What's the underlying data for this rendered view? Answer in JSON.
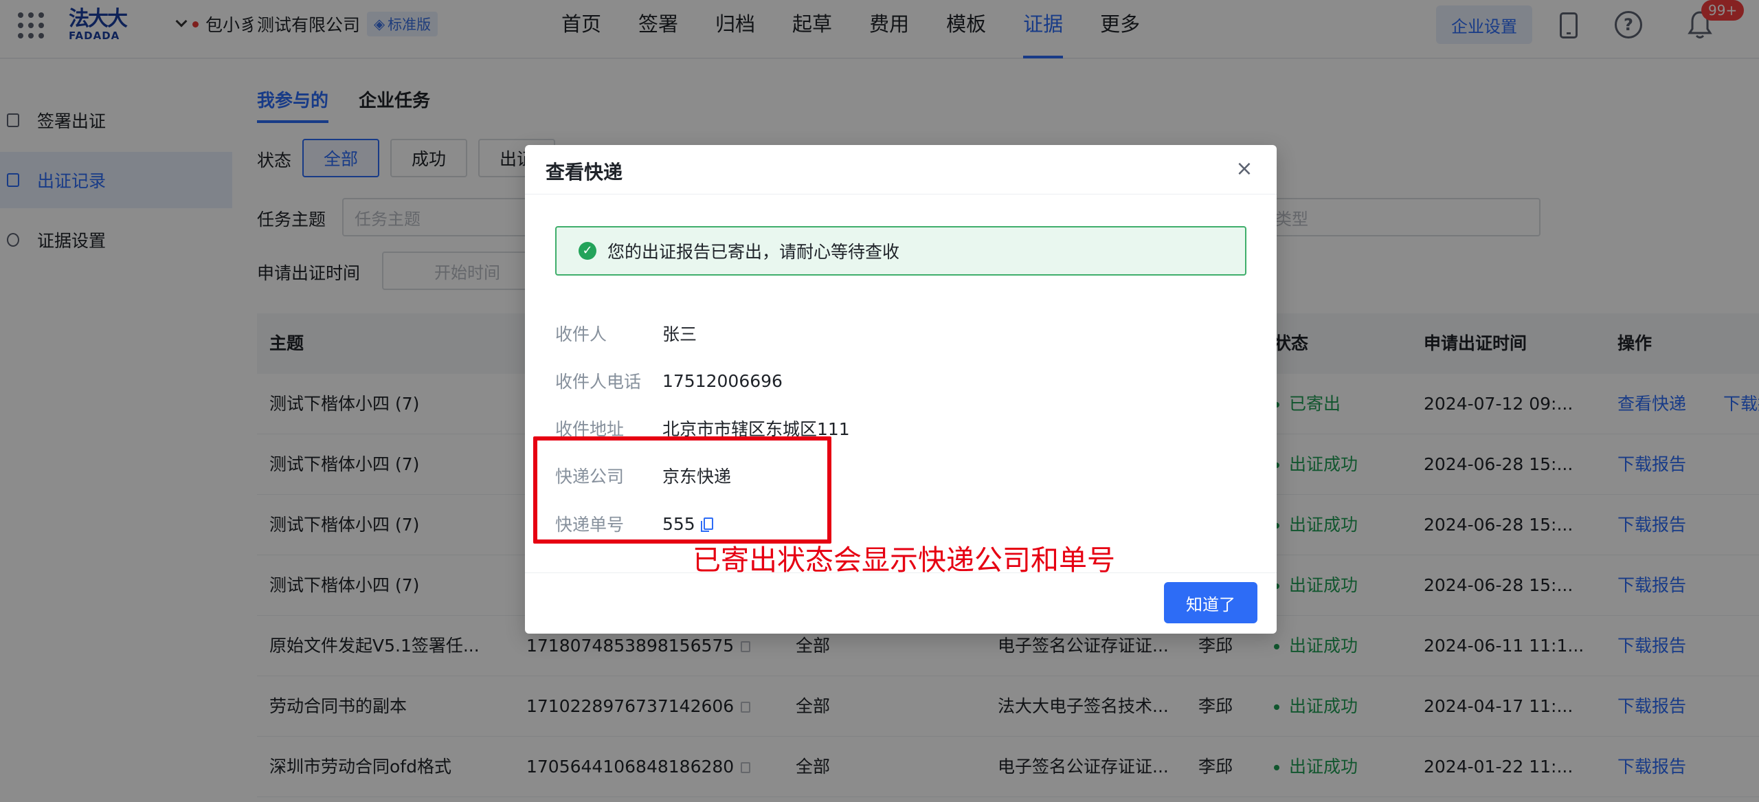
{
  "header": {
    "logo_cn": "法大大",
    "logo_en": "FADADA",
    "company_name": "包小豸测试有限公司",
    "edition": "标准版",
    "nav": [
      "首页",
      "签署",
      "归档",
      "起草",
      "费用",
      "模板",
      "证据",
      "更多"
    ],
    "active_nav": "证据",
    "enterprise_settings": "企业设置",
    "notification_badge": "99+"
  },
  "sidebar": {
    "items": [
      {
        "label": "签署出证",
        "icon": "document-icon"
      },
      {
        "label": "出证记录",
        "icon": "record-icon"
      },
      {
        "label": "证据设置",
        "icon": "gear-icon"
      }
    ],
    "active": "出证记录"
  },
  "main": {
    "tabs": [
      "我参与的",
      "企业任务"
    ],
    "filters": {
      "status_label": "状态",
      "status_options": [
        "全部",
        "成功",
        "出证"
      ],
      "topic_label": "任务主题",
      "topic_placeholder": "任务主题",
      "type_placeholder": "类型",
      "time_label": "申请出证时间",
      "start_placeholder": "开始时间"
    },
    "table": {
      "headers": {
        "topic": "主题",
        "status": "状态",
        "apply_time": "申请出证时间",
        "ops": "操作"
      },
      "rows": [
        {
          "topic": "测试下楷体小四 (7)",
          "id": "",
          "scope": "",
          "org": "",
          "user": "",
          "status": "已寄出",
          "time": "2024-07-12 09:...",
          "ops": [
            "查看快递",
            "下载报告"
          ]
        },
        {
          "topic": "测试下楷体小四 (7)",
          "id": "",
          "scope": "",
          "org": "",
          "user": "",
          "status": "出证成功",
          "time": "2024-06-28 15:...",
          "ops": [
            "下载报告"
          ]
        },
        {
          "topic": "测试下楷体小四 (7)",
          "id": "",
          "scope": "",
          "org": "",
          "user": "",
          "status": "出证成功",
          "time": "2024-06-28 15:...",
          "ops": [
            "下载报告"
          ]
        },
        {
          "topic": "测试下楷体小四 (7)",
          "id": "",
          "scope": "",
          "org": "",
          "user": "",
          "status": "出证成功",
          "time": "2024-06-28 15:...",
          "ops": [
            "下载报告"
          ]
        },
        {
          "topic": "原始文件发起V5.1签署任...",
          "id": "1718074853898156575",
          "scope": "全部",
          "org": "电子签名公证存证证...",
          "user": "李邱",
          "status": "出证成功",
          "time": "2024-06-11 11:1...",
          "ops": [
            "下载报告"
          ]
        },
        {
          "topic": "劳动合同书的副本",
          "id": "1710228976737142606",
          "scope": "全部",
          "org": "法大大电子签名技术...",
          "user": "李邱",
          "status": "出证成功",
          "time": "2024-04-17 11:...",
          "ops": [
            "下载报告"
          ]
        },
        {
          "topic": "深圳市劳动合同ofd格式",
          "id": "1705644106848186280",
          "scope": "全部",
          "org": "电子签名公证存证证...",
          "user": "李邱",
          "status": "出证成功",
          "time": "2024-01-22 11:...",
          "ops": [
            "下载报告"
          ]
        }
      ]
    }
  },
  "modal": {
    "title": "查看快递",
    "alert": "您的出证报告已寄出，请耐心等待查收",
    "fields": [
      {
        "key": "收件人",
        "value": "张三"
      },
      {
        "key": "收件人电话",
        "value": "17512006696"
      },
      {
        "key": "收件地址",
        "value": "北京市市辖区东城区111"
      },
      {
        "key": "快递公司",
        "value": "京东快递"
      },
      {
        "key": "快递单号",
        "value": "555"
      }
    ],
    "annotation": "已寄出状态会显示快递公司和单号",
    "ok_button": "知道了"
  }
}
